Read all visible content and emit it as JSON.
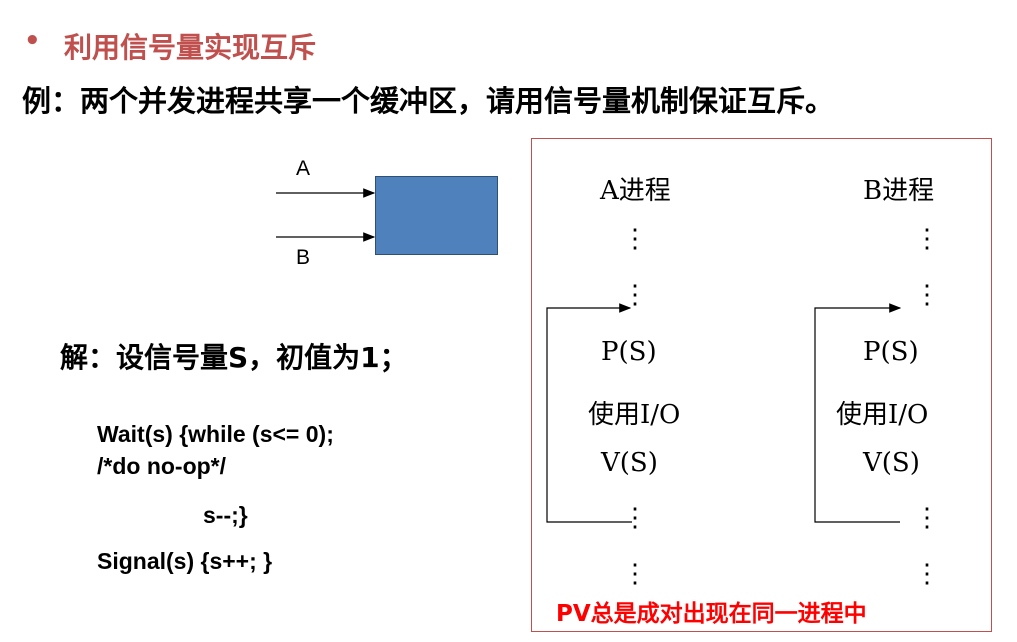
{
  "slide": {
    "bullet": "•",
    "title": "利用信号量实现互斥",
    "example": "例：两个并发进程共享一个缓冲区，请用信号量机制保证互斥。"
  },
  "diagram": {
    "label_a": "A",
    "label_b": "B",
    "buffer_color": "#4f81bd"
  },
  "solution": {
    "text": "解：设信号量S，初值为1；",
    "code_lines": [
      "Wait(s) {while (s<= 0);",
      "/*do no-op*/",
      "s--;}",
      "Signal(s) {s++; }"
    ]
  },
  "panel": {
    "process_a": {
      "title": "A进程",
      "p": "P(S)",
      "use": "使用I/O",
      "v": "V(S)"
    },
    "process_b": {
      "title": "B进程",
      "p": "P(S)",
      "use": "使用I/O",
      "v": "V(S)"
    },
    "dots": "⋮",
    "note": "PV总是成对出现在同一进程中",
    "border_color": "#c0504d",
    "note_color": "#ff0000"
  }
}
